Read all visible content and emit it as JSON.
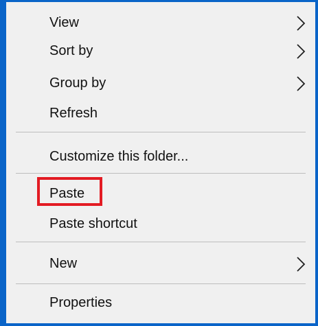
{
  "menu": {
    "view": "View",
    "sort_by": "Sort by",
    "group_by": "Group by",
    "refresh": "Refresh",
    "customize": "Customize this folder...",
    "paste": "Paste",
    "paste_shortcut": "Paste shortcut",
    "new": "New",
    "properties": "Properties"
  },
  "icons": {
    "submenu_arrow": "chevron-right-icon"
  },
  "colors": {
    "window_border": "#0a64c8",
    "menu_background": "#f0f0f0",
    "separator": "#bdbdbd",
    "highlight_box": "#e31b23",
    "text": "#111111"
  }
}
